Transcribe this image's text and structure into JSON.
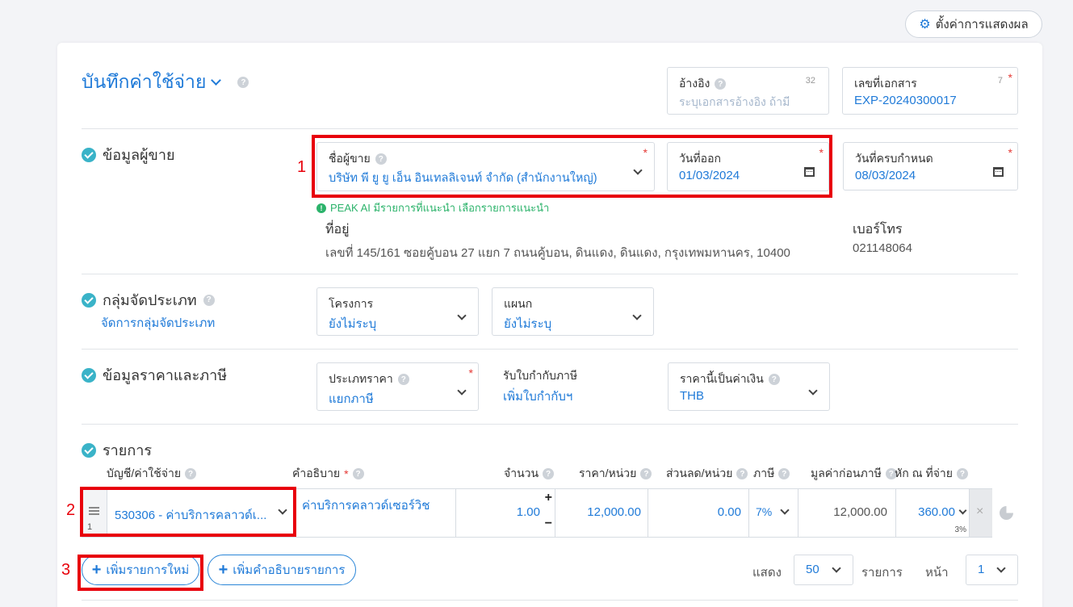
{
  "settings_button": {
    "label": "ตั้งค่าการแสดงผล"
  },
  "header": {
    "title": "บันทึกค่าใช้จ่าย"
  },
  "reference_field": {
    "label": "อ้างอิง",
    "counter": "32",
    "placeholder": "ระบุเอกสารอ้างอิง ถ้ามี"
  },
  "doc_number_field": {
    "label": "เลขที่เอกสาร",
    "counter": "7",
    "value": "EXP-20240300017"
  },
  "vendor_section": {
    "title": "ข้อมูลผู้ขาย",
    "vendor_name": {
      "label": "ชื่อผู้ขาย",
      "value": "บริษัท พี ยู ยู เอ็น อินเทลลิเจนท์ จำกัด (สำนักงานใหญ่)"
    },
    "issue_date": {
      "label": "วันที่ออก",
      "value": "01/03/2024"
    },
    "due_date": {
      "label": "วันที่ครบกำหนด",
      "value": "08/03/2024"
    },
    "ai_hint": "PEAK AI มีรายการที่แนะนำ เลือกรายการแนะนำ",
    "address_label": "ที่อยู่",
    "address_value": "เลขที่ 145/161 ซอยคู้บอน 27 แยก 7 ถนนคู้บอน, ดินแดง, ดินแดง, กรุงเทพมหานคร, 10400",
    "phone_label": "เบอร์โทร",
    "phone_value": "021148064"
  },
  "category_section": {
    "title": "กลุ่มจัดประเภท",
    "manage_link": "จัดการกลุ่มจัดประเภท",
    "project": {
      "label": "โครงการ",
      "value": "ยังไม่ระบุ"
    },
    "department": {
      "label": "แผนก",
      "value": "ยังไม่ระบุ"
    }
  },
  "price_section": {
    "title": "ข้อมูลราคาและภาษี",
    "price_type": {
      "label": "ประเภทราคา",
      "value": "แยกภาษี"
    },
    "wht_label": "รับใบกำกับภาษี",
    "wht_link": "เพิ่มใบกำกับฯ",
    "currency": {
      "label": "ราคานี้เป็นค่าเงิน",
      "value": "THB"
    }
  },
  "items_section": {
    "title": "รายการ",
    "columns": {
      "account": "บัญชี/ค่าใช้จ่าย",
      "description": "คำอธิบาย",
      "quantity": "จำนวน",
      "unit_price": "ราคา/หน่วย",
      "discount": "ส่วนลด/หน่วย",
      "tax": "ภาษี",
      "pretax": "มูลค่าก่อนภาษี",
      "withholding": "หัก ณ ที่จ่าย"
    },
    "row": {
      "index": "1",
      "account": "530306 - ค่าบริการคลาวด์เ...",
      "description": "ค่าบริการคลาวด์เซอร์วิช",
      "quantity": "1.00",
      "unit_price": "12,000.00",
      "discount": "0.00",
      "tax": "7%",
      "pretax": "12,000.00",
      "withholding": "360.00",
      "withholding_rate": "3%"
    },
    "add_item_button": "เพิ่มรายการใหม่",
    "add_desc_button": "เพิ่มคำอธิบายรายการ",
    "show_label": "แสดง",
    "page_size": "50",
    "items_label": "รายการ",
    "page_label": "หน้า",
    "page_number": "1"
  },
  "annotations": {
    "one": "1",
    "two": "2",
    "three": "3"
  },
  "colors": {
    "accent": "#1f7ad8",
    "highlight": "#e8000b",
    "check": "#3ab3c8",
    "hint": "#2cb36b"
  }
}
